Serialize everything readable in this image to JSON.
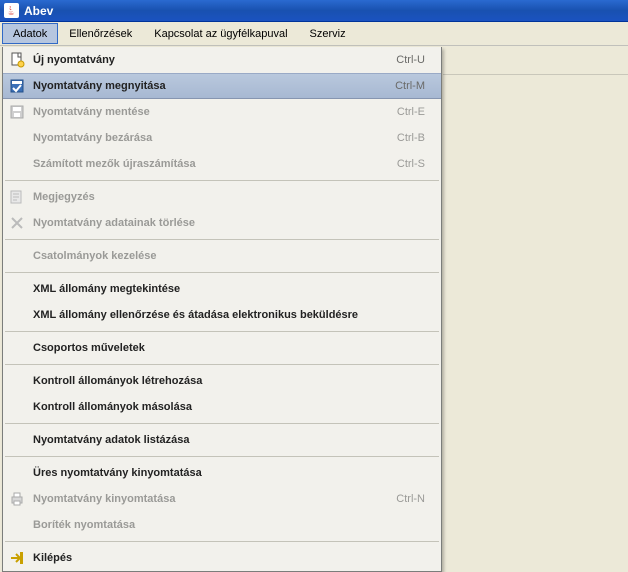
{
  "window": {
    "title": "Abev"
  },
  "menubar": {
    "items": [
      {
        "label": "Adatok",
        "active": true
      },
      {
        "label": "Ellenőrzések",
        "active": false
      },
      {
        "label": "Kapcsolat az ügyfélkapuval",
        "active": false
      },
      {
        "label": "Szerviz",
        "active": false
      }
    ]
  },
  "dropdown": {
    "groups": [
      [
        {
          "icon": "new-doc-icon",
          "label": "Új nyomtatvány",
          "shortcut": "Ctrl-U",
          "enabled": true,
          "highlight": false
        },
        {
          "icon": "open-icon",
          "label": "Nyomtatvány megnyitása",
          "shortcut": "Ctrl-M",
          "enabled": true,
          "highlight": true
        },
        {
          "icon": "save-icon",
          "label": "Nyomtatvány mentése",
          "shortcut": "Ctrl-E",
          "enabled": false,
          "highlight": false
        },
        {
          "icon": "",
          "label": "Nyomtatvány bezárása",
          "shortcut": "Ctrl-B",
          "enabled": false,
          "highlight": false
        },
        {
          "icon": "",
          "label": "Számított mezők újraszámítása",
          "shortcut": "Ctrl-S",
          "enabled": false,
          "highlight": false
        }
      ],
      [
        {
          "icon": "note-icon",
          "label": "Megjegyzés",
          "shortcut": "",
          "enabled": false,
          "highlight": false
        },
        {
          "icon": "delete-icon",
          "label": "Nyomtatvány adatainak törlése",
          "shortcut": "",
          "enabled": false,
          "highlight": false
        }
      ],
      [
        {
          "icon": "",
          "label": "Csatolmányok kezelése",
          "shortcut": "",
          "enabled": false,
          "highlight": false
        }
      ],
      [
        {
          "icon": "",
          "label": "XML állomány megtekintése",
          "shortcut": "",
          "enabled": true,
          "highlight": false
        },
        {
          "icon": "",
          "label": "XML állomány ellenőrzése és átadása elektronikus beküldésre",
          "shortcut": "",
          "enabled": true,
          "highlight": false
        }
      ],
      [
        {
          "icon": "",
          "label": "Csoportos műveletek",
          "shortcut": "",
          "enabled": true,
          "highlight": false
        }
      ],
      [
        {
          "icon": "",
          "label": "Kontroll állományok létrehozása",
          "shortcut": "",
          "enabled": true,
          "highlight": false
        },
        {
          "icon": "",
          "label": "Kontroll állományok másolása",
          "shortcut": "",
          "enabled": true,
          "highlight": false
        }
      ],
      [
        {
          "icon": "",
          "label": "Nyomtatvány adatok listázása",
          "shortcut": "",
          "enabled": true,
          "highlight": false
        }
      ],
      [
        {
          "icon": "",
          "label": "Üres nyomtatvány kinyomtatása",
          "shortcut": "",
          "enabled": true,
          "highlight": false
        },
        {
          "icon": "print-icon",
          "label": "Nyomtatvány kinyomtatása",
          "shortcut": "Ctrl-N",
          "enabled": false,
          "highlight": false
        },
        {
          "icon": "",
          "label": "Boríték nyomtatása",
          "shortcut": "",
          "enabled": false,
          "highlight": false
        }
      ],
      [
        {
          "icon": "exit-icon",
          "label": "Kilépés",
          "shortcut": "",
          "enabled": true,
          "highlight": false
        }
      ]
    ]
  }
}
